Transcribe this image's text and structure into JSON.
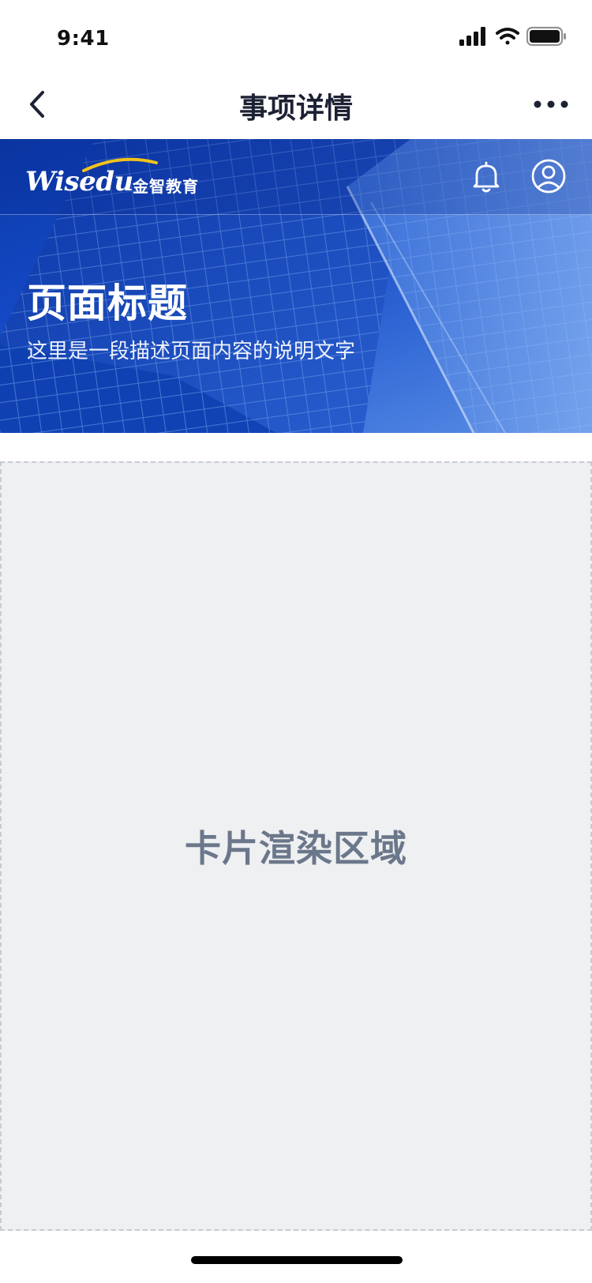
{
  "status_bar": {
    "time": "9:41",
    "icons": [
      "signal-icon",
      "wifi-icon",
      "battery-icon"
    ]
  },
  "nav": {
    "title": "事项详情",
    "back_icon": "chevron-left-icon",
    "more_icon": "more-horizontal-icon"
  },
  "banner": {
    "logo_text": "Wisedu",
    "logo_cn": "金智教育",
    "title": "页面标题",
    "description": "这里是一段描述页面内容的说明文字",
    "bell_icon": "bell-icon",
    "user_icon": "user-circle-icon",
    "accent_color": "#1448c4"
  },
  "card_area": {
    "label": "卡片渲染区域",
    "background": "#eff0f2"
  }
}
